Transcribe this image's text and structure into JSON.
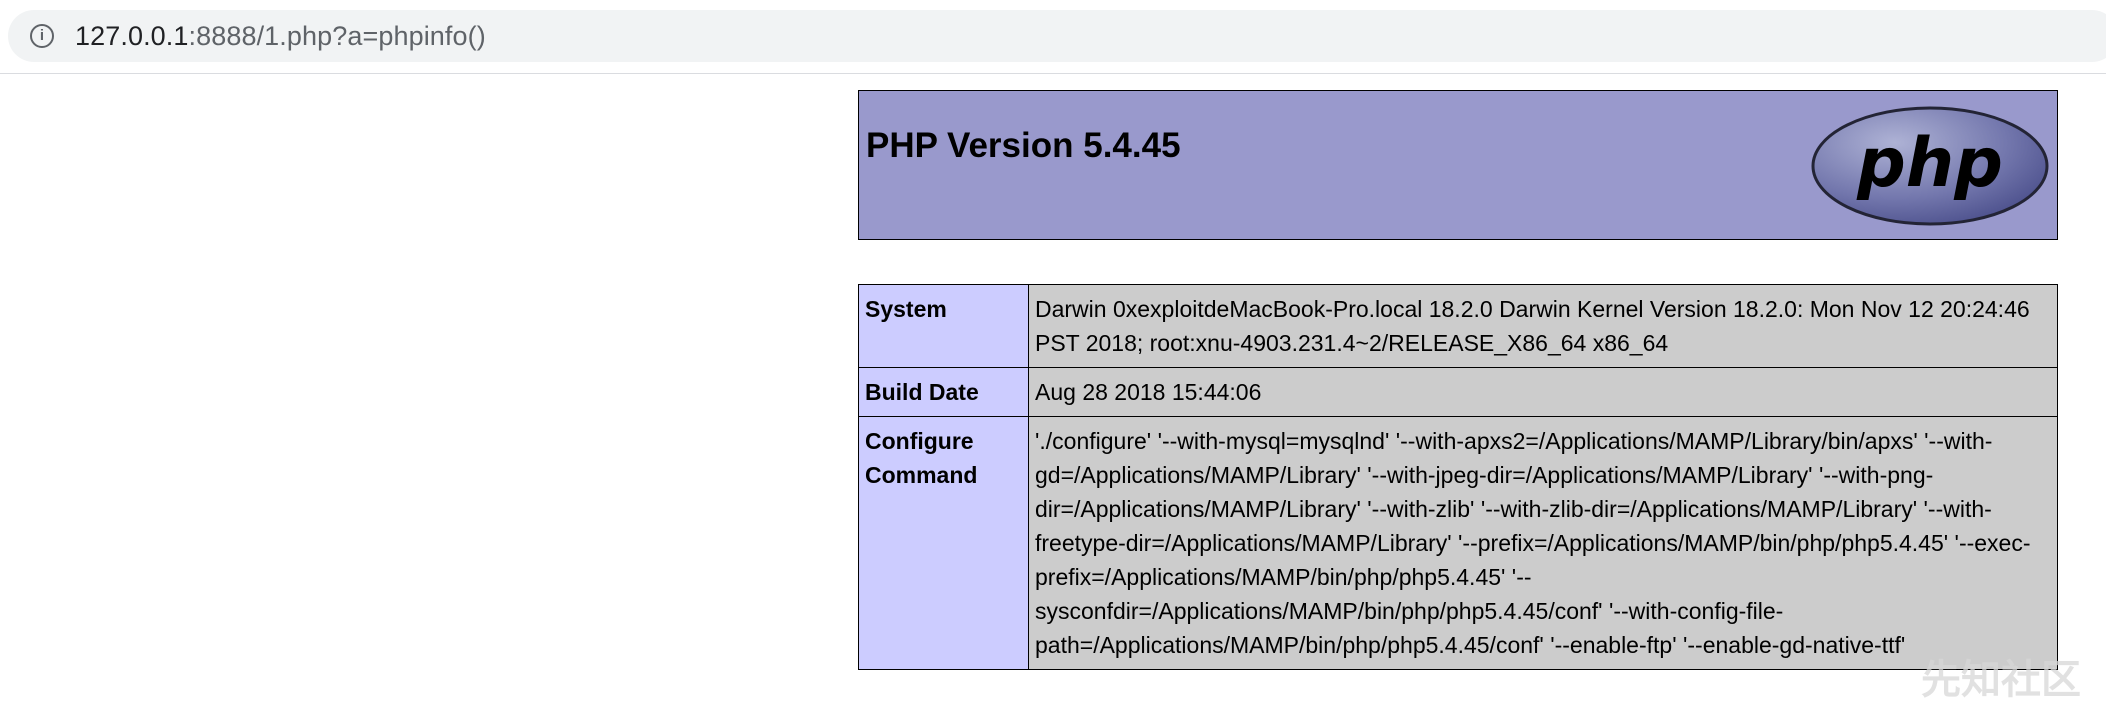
{
  "browser": {
    "url_host": "127.0.0.1",
    "url_rest": ":8888/1.php?a=phpinfo()",
    "info_icon": "info-icon"
  },
  "header": {
    "title": "PHP Version 5.4.45",
    "logo_text": "php"
  },
  "rows": [
    {
      "label": "System",
      "value": "Darwin 0xexploitdeMacBook-Pro.local 18.2.0 Darwin Kernel Version 18.2.0: Mon Nov 12 20:24:46 PST 2018; root:xnu-4903.231.4~2/RELEASE_X86_64 x86_64"
    },
    {
      "label": "Build Date",
      "value": "Aug 28 2018 15:44:06"
    },
    {
      "label": "Configure Command",
      "value": "'./configure' '--with-mysql=mysqlnd' '--with-apxs2=/Applications/MAMP/Library/bin/apxs' '--with-gd=/Applications/MAMP/Library' '--with-jpeg-dir=/Applications/MAMP/Library' '--with-png-dir=/Applications/MAMP/Library' '--with-zlib' '--with-zlib-dir=/Applications/MAMP/Library' '--with-freetype-dir=/Applications/MAMP/Library' '--prefix=/Applications/MAMP/bin/php/php5.4.45' '--exec-prefix=/Applications/MAMP/bin/php/php5.4.45' '--sysconfdir=/Applications/MAMP/bin/php/php5.4.45/conf' '--with-config-file-path=/Applications/MAMP/bin/php/php5.4.45/conf' '--enable-ftp' '--enable-gd-native-ttf'"
    }
  ],
  "watermark": "先知社区"
}
